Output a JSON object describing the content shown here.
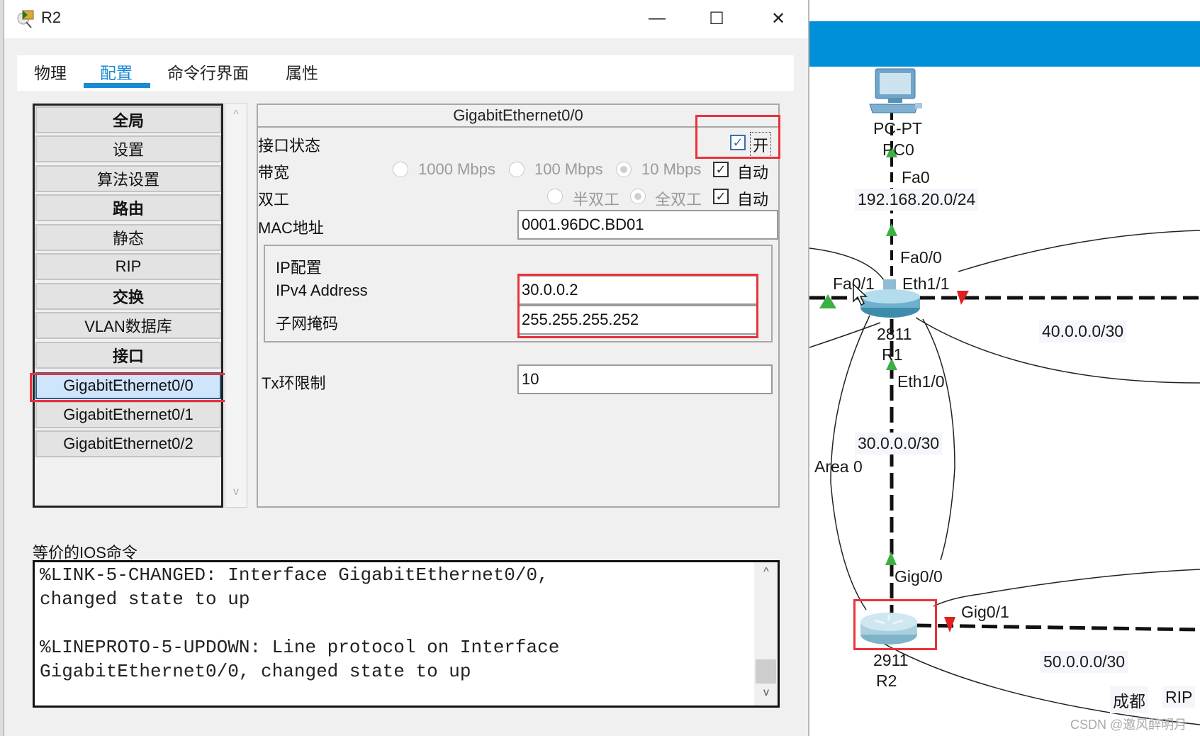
{
  "window": {
    "title": "R2",
    "icon": "packet-tracer-router-icon",
    "controls": {
      "minimize": "—",
      "maximize": "☐",
      "close": "✕"
    }
  },
  "tabs": [
    {
      "label": "物理",
      "active": false
    },
    {
      "label": "配置",
      "active": true
    },
    {
      "label": "命令行界面",
      "active": false
    },
    {
      "label": "属性",
      "active": false
    }
  ],
  "nav": {
    "items": [
      {
        "label": "全局",
        "bold": true,
        "selected": false
      },
      {
        "label": "设置",
        "bold": false,
        "selected": false
      },
      {
        "label": "算法设置",
        "bold": false,
        "selected": false
      },
      {
        "label": "路由",
        "bold": true,
        "selected": false
      },
      {
        "label": "静态",
        "bold": false,
        "selected": false
      },
      {
        "label": "RIP",
        "bold": false,
        "selected": false
      },
      {
        "label": "交换",
        "bold": true,
        "selected": false
      },
      {
        "label": "VLAN数据库",
        "bold": false,
        "selected": false
      },
      {
        "label": "接口",
        "bold": true,
        "selected": false
      },
      {
        "label": "GigabitEthernet0/0",
        "bold": false,
        "selected": true
      },
      {
        "label": "GigabitEthernet0/1",
        "bold": false,
        "selected": false
      },
      {
        "label": "GigabitEthernet0/2",
        "bold": false,
        "selected": false
      }
    ],
    "scroll_up": "^",
    "scroll_down": "v"
  },
  "interface": {
    "header": "GigabitEthernet0/0",
    "port_status": {
      "label": "接口状态",
      "checked": true,
      "check_glyph": "✓",
      "value_label": "开"
    },
    "bandwidth": {
      "label": "带宽",
      "options": [
        {
          "label": "1000 Mbps",
          "selected": false
        },
        {
          "label": "100 Mbps",
          "selected": false
        },
        {
          "label": "10 Mbps",
          "selected": true
        }
      ],
      "auto": {
        "label": "自动",
        "checked": true,
        "check_glyph": "✓"
      }
    },
    "duplex": {
      "label": "双工",
      "options": [
        {
          "label": "半双工",
          "selected": false
        },
        {
          "label": "全双工",
          "selected": true
        }
      ],
      "auto": {
        "label": "自动",
        "checked": true,
        "check_glyph": "✓"
      }
    },
    "mac": {
      "label": "MAC地址",
      "value": "0001.96DC.BD01"
    },
    "ip_config": {
      "title": "IP配置",
      "ipv4_label": "IPv4 Address",
      "ipv4_value": "30.0.0.2",
      "mask_label": "子网掩码",
      "mask_value": "255.255.255.252"
    },
    "tx_ring": {
      "label": "Tx环限制",
      "value": "10"
    }
  },
  "ios": {
    "label": "等价的IOS命令",
    "lines": "%LINK-5-CHANGED: Interface GigabitEthernet0/0,\nchanged state to up\n\n%LINEPROTO-5-UPDOWN: Line protocol on Interface\nGigabitEthernet0/0, changed state to up",
    "scroll_up": "^",
    "scroll_down": "v"
  },
  "topology": {
    "pc": {
      "model": "PC-PT",
      "name": "PC0",
      "port": "Fa0"
    },
    "lan_network": "192.168.20.0/24",
    "r1": {
      "model": "2811",
      "name": "R1",
      "ports": [
        "Fa0/0",
        "Fa0/1",
        "Eth1/1",
        "Eth1/0"
      ]
    },
    "r2": {
      "model": "2911",
      "name": "R2",
      "ports": [
        "Gig0/0",
        "Gig0/1"
      ]
    },
    "networks": [
      "40.0.0.0/30",
      "30.0.0.0/30",
      "50.0.0.0/30"
    ],
    "area_label": "Area 0",
    "region_label": "成都",
    "protocol_label": "RIP",
    "link_up_color": "#3cb043",
    "link_down_color": "#e02020"
  },
  "watermark": "CSDN @邀风醉明月",
  "colors": {
    "accent": "#1a8ad4",
    "highlight": "#e8333b",
    "canvas_bar": "#0090d8"
  }
}
